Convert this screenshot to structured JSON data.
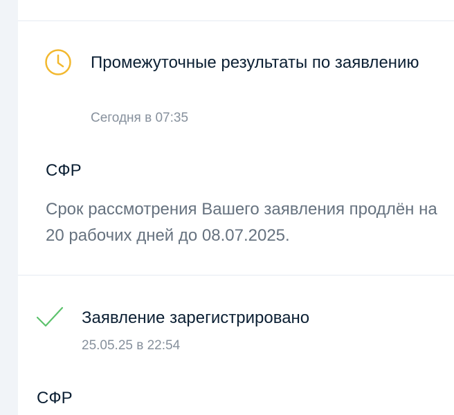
{
  "events": [
    {
      "icon": "clock-icon",
      "status": "Промежуточные результаты по заявлению",
      "time": "Сегодня в 07:35",
      "org": "СФР",
      "message": "Срок рассмотрения Вашего заявления продлён на 20 рабочих дней до 08.07.2025."
    },
    {
      "icon": "check-icon",
      "status": "Заявление зарегистрировано",
      "time": "25.05.25 в 22:54",
      "org": "СФР"
    }
  ],
  "colors": {
    "background": "#f1f4f8",
    "card": "#ffffff",
    "pending": "#f2b82e",
    "success": "#5cc26c",
    "text_primary": "#0b1f33",
    "text_secondary": "#86909c",
    "text_message": "#66727f"
  }
}
